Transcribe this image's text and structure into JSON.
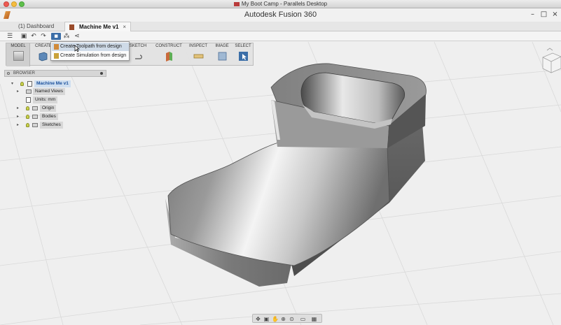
{
  "os_window": {
    "title": "My Boot Camp - Parallels Desktop"
  },
  "app": {
    "title": "Autodesk Fusion 360"
  },
  "tabs": [
    {
      "label": "(1) Dashboard"
    },
    {
      "label": "Machine Me v1",
      "close": "×"
    }
  ],
  "quick_toolbar": {
    "icons": [
      "menu-icon",
      "save-icon",
      "undo-icon",
      "redo-icon",
      "cam-icon",
      "simulation-icon",
      "share-icon"
    ],
    "right_icon": "comment-icon"
  },
  "ribbon": {
    "workspace": "MODEL",
    "groups": [
      "CREATE",
      "SKETCH",
      "CONSTRUCT",
      "INSPECT",
      "IMAGE",
      "SELECT"
    ]
  },
  "dropdown": {
    "items": [
      {
        "label": "Create Toolpath from design",
        "highlighted": true
      },
      {
        "label": "Create Simulation from design",
        "highlighted": false
      }
    ]
  },
  "browser": {
    "title": "BROWSER",
    "root": "Machine Me v1",
    "items": [
      {
        "label": "Named Views"
      },
      {
        "label": "Units: mm"
      },
      {
        "label": "Origin"
      },
      {
        "label": "Bodies"
      },
      {
        "label": "Sketches"
      }
    ]
  },
  "navbar": {
    "icons": [
      "orbit-icon",
      "look-at-icon",
      "pan-icon",
      "zoom-icon",
      "fit-icon",
      "display-settings-icon",
      "grid-settings-icon"
    ]
  },
  "colors": {
    "accent": "#3b6ea8",
    "root_label": "#1a4f9a",
    "canvas": "#efefef"
  }
}
